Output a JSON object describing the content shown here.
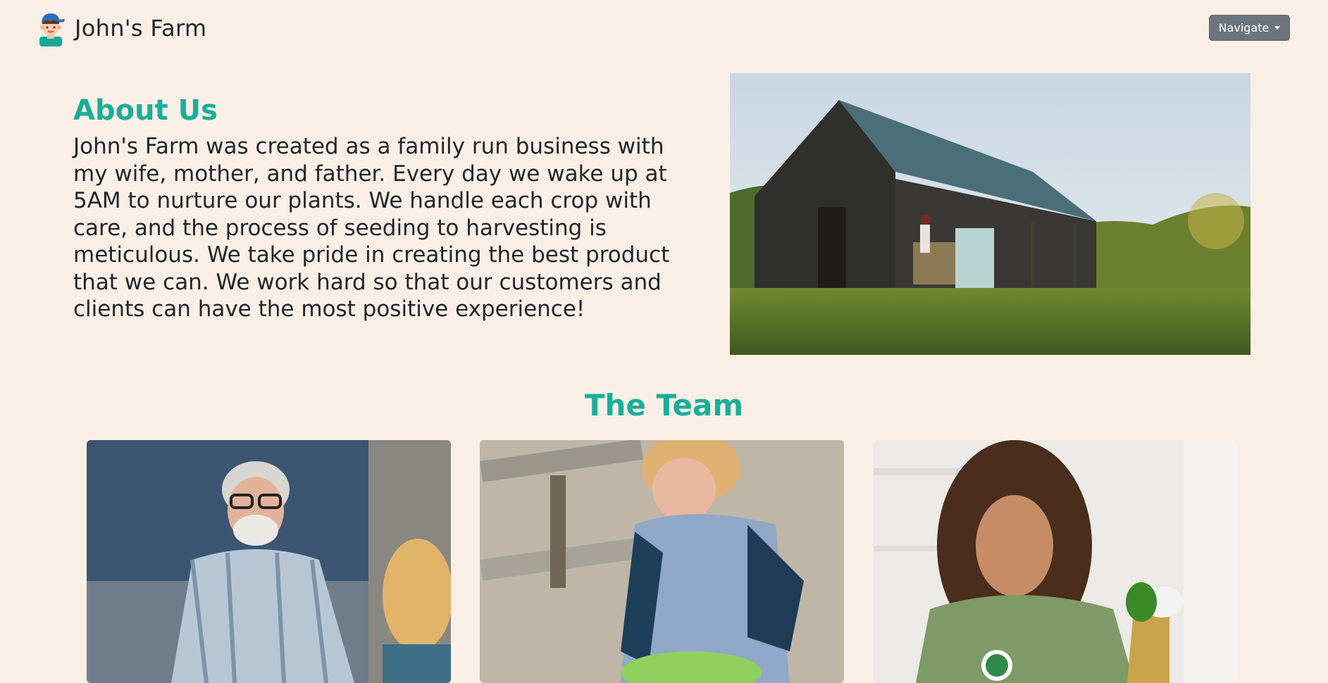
{
  "header": {
    "brand_name": "John's Farm",
    "logo_icon": "farmer-avatar-icon",
    "nav_button_label": "Navigate"
  },
  "about": {
    "title": "About Us",
    "body": "John's Farm was created as a family run business with my wife, mother, and father. Every day we wake up at 5AM to nurture our plants. We handle each crop with care, and the process of seeding to harvesting is meticulous. We take pride in creating the best product that we can. We work hard so that our customers and clients can have the most positive experience!",
    "image": "barn-photo"
  },
  "team": {
    "title": "The Team",
    "members": [
      {
        "image": "older-man-with-child-photo"
      },
      {
        "image": "woman-gardening-photo"
      },
      {
        "image": "young-woman-watering-plant-photo"
      }
    ]
  },
  "colors": {
    "background": "#faefe6",
    "accent": "#1aae9a",
    "button": "#6c757d",
    "text": "#212529"
  }
}
